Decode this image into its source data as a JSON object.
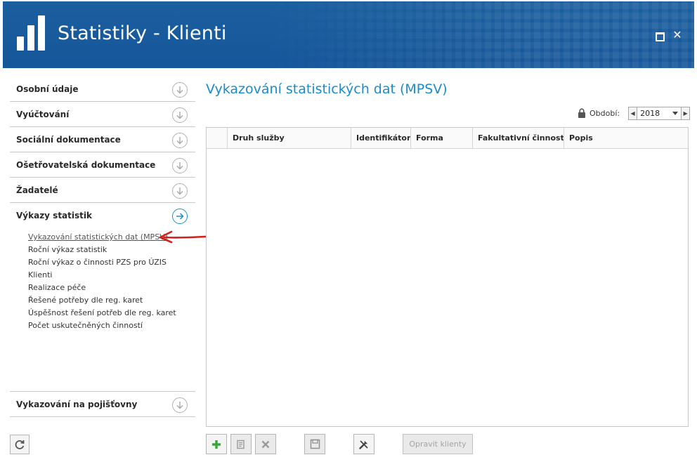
{
  "header": {
    "title": "Statistiky - Klienti"
  },
  "sidebar": {
    "items": [
      {
        "label": "Osobní údaje"
      },
      {
        "label": "Vyúčtování"
      },
      {
        "label": "Sociální dokumentace"
      },
      {
        "label": "Ošetřovatelská dokumentace"
      },
      {
        "label": "Žadatelé"
      },
      {
        "label": "Výkazy statistik"
      },
      {
        "label": "Vykazování na pojišťovny"
      }
    ],
    "subitems": [
      "Vykazování statistických dat (MPSV)",
      "Roční výkaz statistik",
      "Roční výkaz o činnosti PZS pro ÚZIS",
      "Klienti",
      "Realizace péče",
      "Řešené potřeby dle reg. karet",
      "Úspěšnost řešení potřeb dle reg. karet",
      "Počet uskutečněných činností"
    ]
  },
  "main": {
    "title": "Vykazování statistických dat (MPSV)",
    "period": {
      "label": "Období:",
      "value": "2018"
    },
    "grid": {
      "columns": [
        "",
        "Druh služby",
        "Identifikátor",
        "Forma",
        "Fakultativní činnosti",
        "Popis"
      ]
    },
    "toolbar": {
      "fix_clients_label": "Opravit klienty"
    }
  },
  "colors": {
    "header_bg": "#1b5f9f",
    "accent": "#1a8bcd",
    "add_green": "#3aa53a",
    "annotation_red": "#d0221c"
  },
  "icons": [
    "app-logo-icon",
    "maximize-icon",
    "close-icon",
    "chevron-down-circle-icon",
    "arrow-right-circle-icon",
    "lock-icon",
    "refresh-icon",
    "add-icon",
    "edit-icon",
    "delete-icon",
    "save-icon",
    "tools-icon"
  ]
}
